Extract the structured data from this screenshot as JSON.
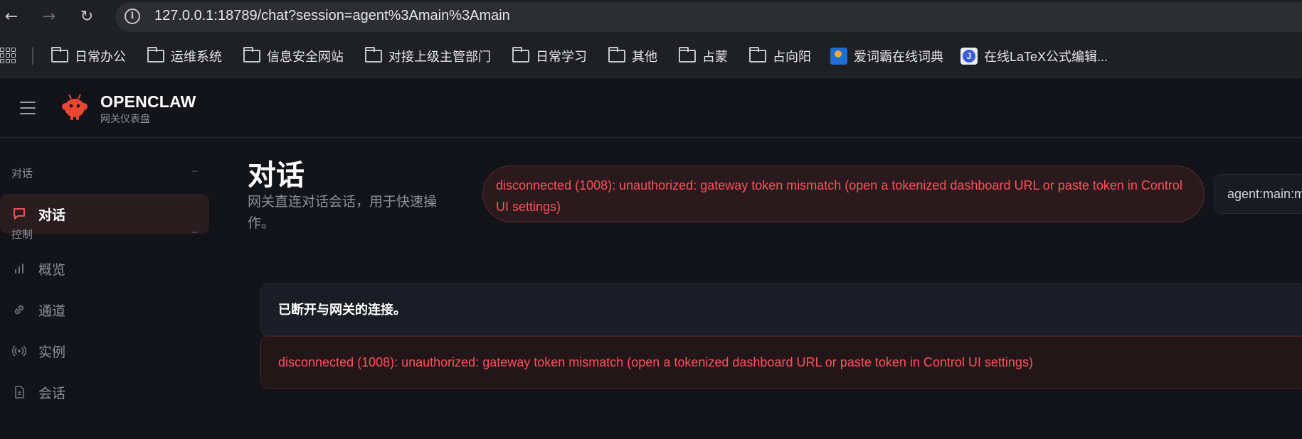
{
  "browser": {
    "url": "127.0.0.1:18789/chat?session=agent%3Amain%3Amain",
    "bookmarks": [
      {
        "label": "日常办公",
        "icon": "folder-icon"
      },
      {
        "label": "运维系统",
        "icon": "folder-icon"
      },
      {
        "label": "信息安全网站",
        "icon": "folder-icon"
      },
      {
        "label": "对接上级主管部门",
        "icon": "folder-icon"
      },
      {
        "label": "日常学习",
        "icon": "folder-icon"
      },
      {
        "label": "其他",
        "icon": "folder-icon"
      },
      {
        "label": "占蒙",
        "icon": "folder-icon"
      },
      {
        "label": "占向阳",
        "icon": "folder-icon"
      },
      {
        "label": "爱词霸在线词典",
        "icon": "iciba-favicon"
      },
      {
        "label": "在线LaTeX公式编辑...",
        "icon": "latex-favicon"
      }
    ]
  },
  "app": {
    "brand_name": "OPENCLAW",
    "brand_sub": "网关仪表盘",
    "accent_color": "#ff5a5f",
    "error_color": "#ff4f5a"
  },
  "sidebar": {
    "groups": [
      {
        "label": "对话",
        "collapse": "−"
      },
      {
        "label": "控制",
        "collapse": "−"
      }
    ],
    "items": [
      {
        "label": "对话",
        "icon": "chat-bubble-icon",
        "active": true
      },
      {
        "label": "概览",
        "icon": "bar-chart-icon"
      },
      {
        "label": "通道",
        "icon": "link-icon"
      },
      {
        "label": "实例",
        "icon": "broadcast-icon"
      },
      {
        "label": "会话",
        "icon": "document-icon"
      }
    ]
  },
  "main": {
    "title": "对话",
    "subtitle": "网关直连对话会话，用于快速操作。",
    "error_banner": "disconnected (1008): unauthorized: gateway token mismatch (open a tokenized dashboard URL or paste token in Control UI settings)",
    "session_label": "agent:main:main",
    "disconnect_notice": "已断开与网关的连接。",
    "error_message": "disconnected (1008): unauthorized: gateway token mismatch (open a tokenized dashboard URL or paste token in Control UI settings)"
  }
}
